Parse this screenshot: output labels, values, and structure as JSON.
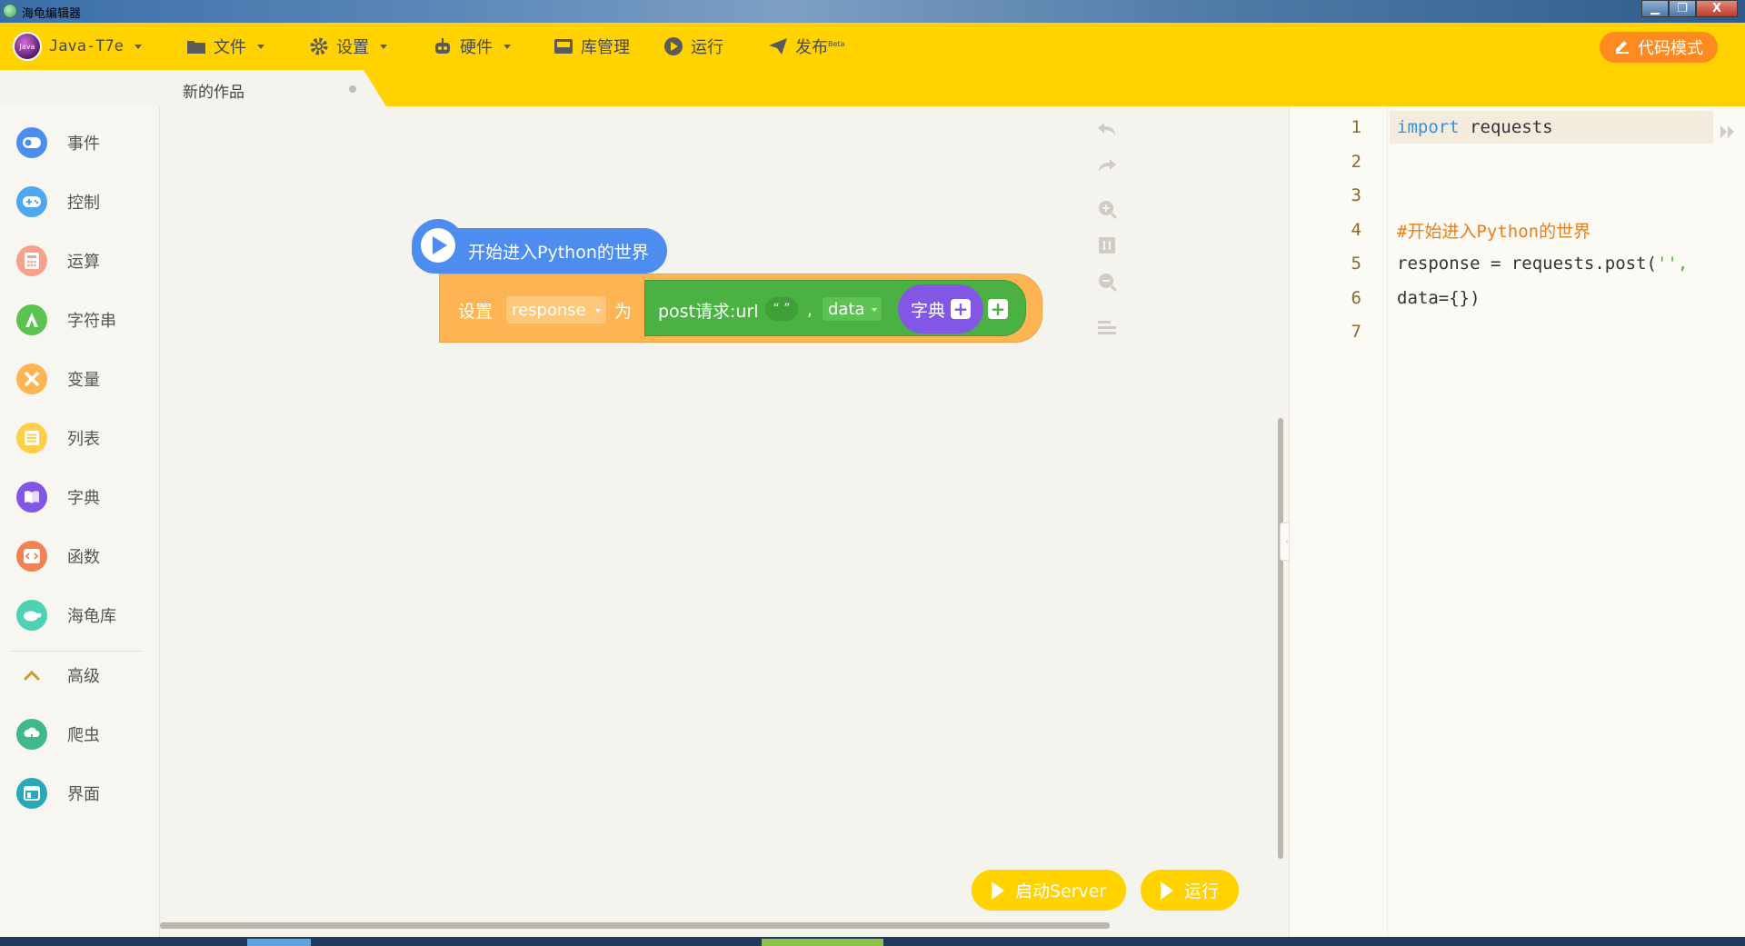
{
  "window": {
    "title": "海龟编辑器",
    "controls": {
      "minimize": "▁",
      "maximize": "❐",
      "close": "X"
    }
  },
  "toolbar": {
    "user": {
      "name": "Java-T7e",
      "avatar_text": "Java"
    },
    "menu": [
      {
        "label": "文件",
        "icon": "folder-icon",
        "dropdown": true
      },
      {
        "label": "设置",
        "icon": "gear-icon",
        "dropdown": true
      },
      {
        "label": "硬件",
        "icon": "robot-icon",
        "dropdown": true
      },
      {
        "label": "库管理",
        "icon": "inbox-icon",
        "dropdown": false
      },
      {
        "label": "运行",
        "icon": "play-circle-icon",
        "dropdown": false
      },
      {
        "label": "发布",
        "icon": "paper-plane-icon",
        "badge": "Beta",
        "dropdown": false
      }
    ],
    "code_mode_label": "代码模式"
  },
  "tabs": [
    {
      "title": "新的作品",
      "active": true
    }
  ],
  "categories": [
    {
      "label": "事件",
      "color": "#4e8df0",
      "icon": "toggle-icon"
    },
    {
      "label": "控制",
      "color": "#4ea8ef",
      "icon": "gamepad-icon"
    },
    {
      "label": "运算",
      "color": "#f7a08b",
      "icon": "calculator-icon"
    },
    {
      "label": "字符串",
      "color": "#5cc352",
      "icon": "string-icon"
    },
    {
      "label": "变量",
      "color": "#ffb454",
      "icon": "variable-x-icon"
    },
    {
      "label": "列表",
      "color": "#ffcf4a",
      "icon": "list-icon"
    },
    {
      "label": "字典",
      "color": "#8257e6",
      "icon": "book-icon"
    },
    {
      "label": "函数",
      "color": "#f28252",
      "icon": "function-icon"
    },
    {
      "label": "海龟库",
      "color": "#4fd1b3",
      "icon": "turtle-icon"
    },
    {
      "label": "高级",
      "color": "#c79a2a",
      "icon": "chevron-up-icon"
    },
    {
      "label": "爬虫",
      "color": "#3fb98a",
      "icon": "spider-cloud-icon"
    },
    {
      "label": "界面",
      "color": "#2aa7b8",
      "icon": "window-icon"
    }
  ],
  "blocks": {
    "hat": {
      "label": "开始进入Python的世界"
    },
    "set": {
      "label": "设置",
      "variable": "response",
      "to_label": "为",
      "post": {
        "label": "post请求:url",
        "url_value": "“ ”",
        "separator": ",",
        "param": "data",
        "dict_label": "字典"
      }
    }
  },
  "run_buttons": {
    "server_label": "启动Server",
    "run_label": "运行"
  },
  "code": {
    "lines": [
      {
        "num": "1",
        "kw": "import",
        "rest": " requests"
      },
      {
        "num": "2",
        "text": ""
      },
      {
        "num": "3",
        "text": ""
      },
      {
        "num": "4",
        "comment": "#开始进入Python的世界"
      },
      {
        "num": "5",
        "text": "response = requests.post(",
        "str": "'',",
        "trail": ""
      },
      {
        "num": "6",
        "text": "data={})"
      },
      {
        "num": "7",
        "text": ""
      }
    ]
  },
  "colors": {
    "accent": "#ffd200",
    "code_mode": "#ff8a1f",
    "hat_block": "#4e8df0",
    "variable_block": "#ffb454",
    "request_block": "#4cb143",
    "dict_block": "#8257e6"
  }
}
